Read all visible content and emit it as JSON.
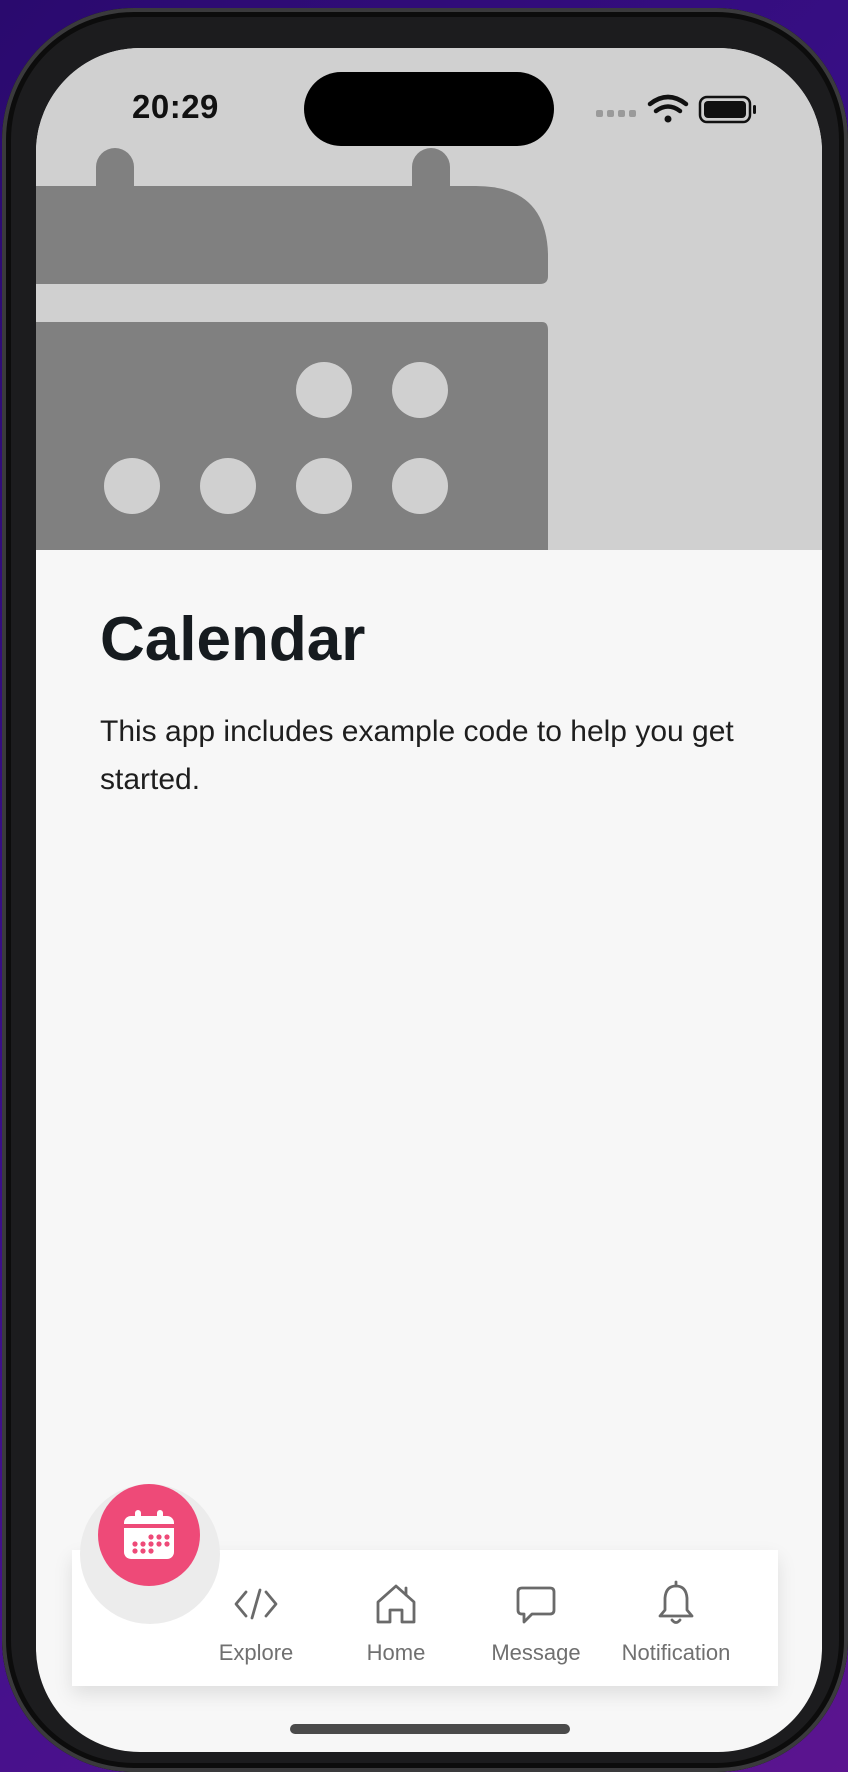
{
  "status_bar": {
    "time": "20:29"
  },
  "page": {
    "title": "Calendar",
    "description": "This app includes example code to help you get started."
  },
  "fab": {
    "icon": "calendar-icon",
    "color": "#ee4a78"
  },
  "tabs": [
    {
      "label": "Explore",
      "icon": "code-icon"
    },
    {
      "label": "Home",
      "icon": "home-icon"
    },
    {
      "label": "Message",
      "icon": "message-icon"
    },
    {
      "label": "Notification",
      "icon": "bell-icon"
    }
  ],
  "colors": {
    "accent": "#ee4a78",
    "hero_bg": "#d0d0d0",
    "hero_shape": "#808080",
    "background": "#f7f7f7"
  }
}
